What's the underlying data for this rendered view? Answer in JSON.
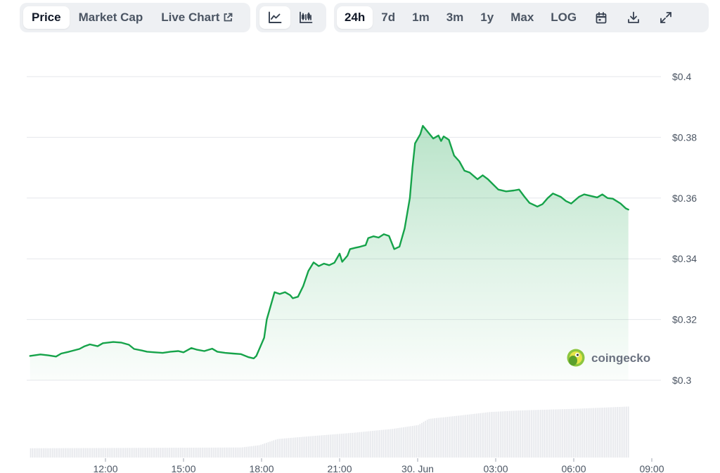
{
  "toolbar": {
    "metric_tabs": [
      {
        "label": "Price",
        "active": true
      },
      {
        "label": "Market Cap",
        "active": false
      },
      {
        "label": "Live Chart",
        "active": false
      }
    ],
    "view_icons": [
      {
        "icon": "line-chart-icon",
        "active": true
      },
      {
        "icon": "candlestick-chart-icon",
        "active": false
      }
    ],
    "ranges": [
      {
        "label": "24h",
        "active": true
      },
      {
        "label": "7d",
        "active": false
      },
      {
        "label": "1m",
        "active": false
      },
      {
        "label": "3m",
        "active": false
      },
      {
        "label": "1y",
        "active": false
      },
      {
        "label": "Max",
        "active": false
      }
    ],
    "log_label": "LOG",
    "tool_icons": [
      "calendar-icon",
      "download-icon",
      "expand-icon"
    ]
  },
  "watermark": {
    "text": "coingecko"
  },
  "colors": {
    "line": "#16a34a",
    "fill": "#16a34a",
    "volume": "#e5e7eb",
    "grid": "#e5e7eb",
    "active_bg": "#ffffff",
    "group_bg": "#eef0f3"
  },
  "chart_data": {
    "type": "area",
    "title": "",
    "xlabel": "",
    "ylabel": "",
    "ylim": [
      0.3,
      0.4
    ],
    "yticks": [
      {
        "value": 0.4,
        "label": "$0.4"
      },
      {
        "value": 0.38,
        "label": "$0.38"
      },
      {
        "value": 0.36,
        "label": "$0.36"
      },
      {
        "value": 0.34,
        "label": "$0.34"
      },
      {
        "value": 0.32,
        "label": "$0.32"
      },
      {
        "value": 0.3,
        "label": "$0.3"
      }
    ],
    "xlim": [
      -2.5,
      21.5
    ],
    "xticks": [
      {
        "value": 0,
        "label": "12:00"
      },
      {
        "value": 3,
        "label": "15:00"
      },
      {
        "value": 6,
        "label": "18:00"
      },
      {
        "value": 9,
        "label": "21:00"
      },
      {
        "value": 12,
        "label": "30. Jun"
      },
      {
        "value": 15,
        "label": "03:00"
      },
      {
        "value": 18,
        "label": "06:00"
      },
      {
        "value": 21,
        "label": "09:00"
      }
    ],
    "x_unit": "hours from 12:00",
    "grid": true,
    "series": [
      {
        "values": [
          [
            -2.9,
            0.308
          ],
          [
            -2.5,
            0.3085
          ],
          [
            -2.2,
            0.3082
          ],
          [
            -1.9,
            0.3078
          ],
          [
            -1.7,
            0.3088
          ],
          [
            -1.4,
            0.3094
          ],
          [
            -1.0,
            0.3103
          ],
          [
            -0.8,
            0.3112
          ],
          [
            -0.6,
            0.3118
          ],
          [
            -0.3,
            0.3112
          ],
          [
            -0.1,
            0.3122
          ],
          [
            0.3,
            0.3126
          ],
          [
            0.6,
            0.3124
          ],
          [
            0.9,
            0.3117
          ],
          [
            1.1,
            0.3103
          ],
          [
            1.4,
            0.3098
          ],
          [
            1.6,
            0.3094
          ],
          [
            1.9,
            0.3092
          ],
          [
            2.2,
            0.309
          ],
          [
            2.5,
            0.3094
          ],
          [
            2.8,
            0.3096
          ],
          [
            3.0,
            0.3092
          ],
          [
            3.3,
            0.3106
          ],
          [
            3.5,
            0.3101
          ],
          [
            3.8,
            0.3096
          ],
          [
            4.1,
            0.3104
          ],
          [
            4.3,
            0.3094
          ],
          [
            4.6,
            0.309
          ],
          [
            4.9,
            0.3088
          ],
          [
            5.2,
            0.3086
          ],
          [
            5.5,
            0.3076
          ],
          [
            5.7,
            0.3072
          ],
          [
            5.8,
            0.308
          ],
          [
            6.0,
            0.312
          ],
          [
            6.1,
            0.314
          ],
          [
            6.2,
            0.32
          ],
          [
            6.4,
            0.326
          ],
          [
            6.5,
            0.329
          ],
          [
            6.7,
            0.3284
          ],
          [
            6.9,
            0.329
          ],
          [
            7.1,
            0.328
          ],
          [
            7.2,
            0.327
          ],
          [
            7.4,
            0.3275
          ],
          [
            7.6,
            0.331
          ],
          [
            7.8,
            0.336
          ],
          [
            8.0,
            0.3388
          ],
          [
            8.2,
            0.3376
          ],
          [
            8.4,
            0.3384
          ],
          [
            8.6,
            0.3379
          ],
          [
            8.8,
            0.3387
          ],
          [
            9.0,
            0.3417
          ],
          [
            9.1,
            0.339
          ],
          [
            9.3,
            0.341
          ],
          [
            9.4,
            0.3432
          ],
          [
            9.6,
            0.3436
          ],
          [
            9.8,
            0.344
          ],
          [
            10.0,
            0.3445
          ],
          [
            10.1,
            0.3468
          ],
          [
            10.3,
            0.3474
          ],
          [
            10.5,
            0.347
          ],
          [
            10.7,
            0.3481
          ],
          [
            10.9,
            0.3475
          ],
          [
            11.1,
            0.3432
          ],
          [
            11.3,
            0.344
          ],
          [
            11.5,
            0.35
          ],
          [
            11.7,
            0.36
          ],
          [
            11.8,
            0.37
          ],
          [
            11.9,
            0.378
          ],
          [
            12.1,
            0.381
          ],
          [
            12.2,
            0.3838
          ],
          [
            12.4,
            0.3817
          ],
          [
            12.6,
            0.3796
          ],
          [
            12.8,
            0.3806
          ],
          [
            12.9,
            0.3788
          ],
          [
            13.0,
            0.3803
          ],
          [
            13.2,
            0.3792
          ],
          [
            13.4,
            0.374
          ],
          [
            13.6,
            0.3721
          ],
          [
            13.8,
            0.369
          ],
          [
            14.0,
            0.3684
          ],
          [
            14.3,
            0.3662
          ],
          [
            14.5,
            0.3675
          ],
          [
            14.7,
            0.3662
          ],
          [
            14.9,
            0.3645
          ],
          [
            15.1,
            0.3628
          ],
          [
            15.4,
            0.3622
          ],
          [
            15.7,
            0.3625
          ],
          [
            15.9,
            0.3628
          ],
          [
            16.1,
            0.3605
          ],
          [
            16.3,
            0.3584
          ],
          [
            16.6,
            0.3572
          ],
          [
            16.8,
            0.358
          ],
          [
            17.0,
            0.36
          ],
          [
            17.2,
            0.3615
          ],
          [
            17.5,
            0.3604
          ],
          [
            17.7,
            0.359
          ],
          [
            17.9,
            0.3582
          ],
          [
            18.2,
            0.3604
          ],
          [
            18.4,
            0.3612
          ],
          [
            18.7,
            0.3606
          ],
          [
            18.9,
            0.3602
          ],
          [
            19.1,
            0.3612
          ],
          [
            19.3,
            0.36
          ],
          [
            19.5,
            0.3598
          ],
          [
            19.8,
            0.3582
          ],
          [
            20.0,
            0.3566
          ],
          [
            20.1,
            0.3562
          ]
        ]
      }
    ],
    "volume": {
      "note": "relative volume, 0 to 1",
      "points": [
        [
          -2.9,
          0.12
        ],
        [
          5.2,
          0.13
        ],
        [
          5.9,
          0.16
        ],
        [
          6.6,
          0.24
        ],
        [
          8.0,
          0.28
        ],
        [
          9.5,
          0.32
        ],
        [
          11.0,
          0.37
        ],
        [
          12.0,
          0.42
        ],
        [
          12.4,
          0.5
        ],
        [
          13.5,
          0.54
        ],
        [
          14.8,
          0.59
        ],
        [
          16.0,
          0.61
        ],
        [
          18.0,
          0.63
        ],
        [
          20.1,
          0.66
        ]
      ]
    }
  }
}
